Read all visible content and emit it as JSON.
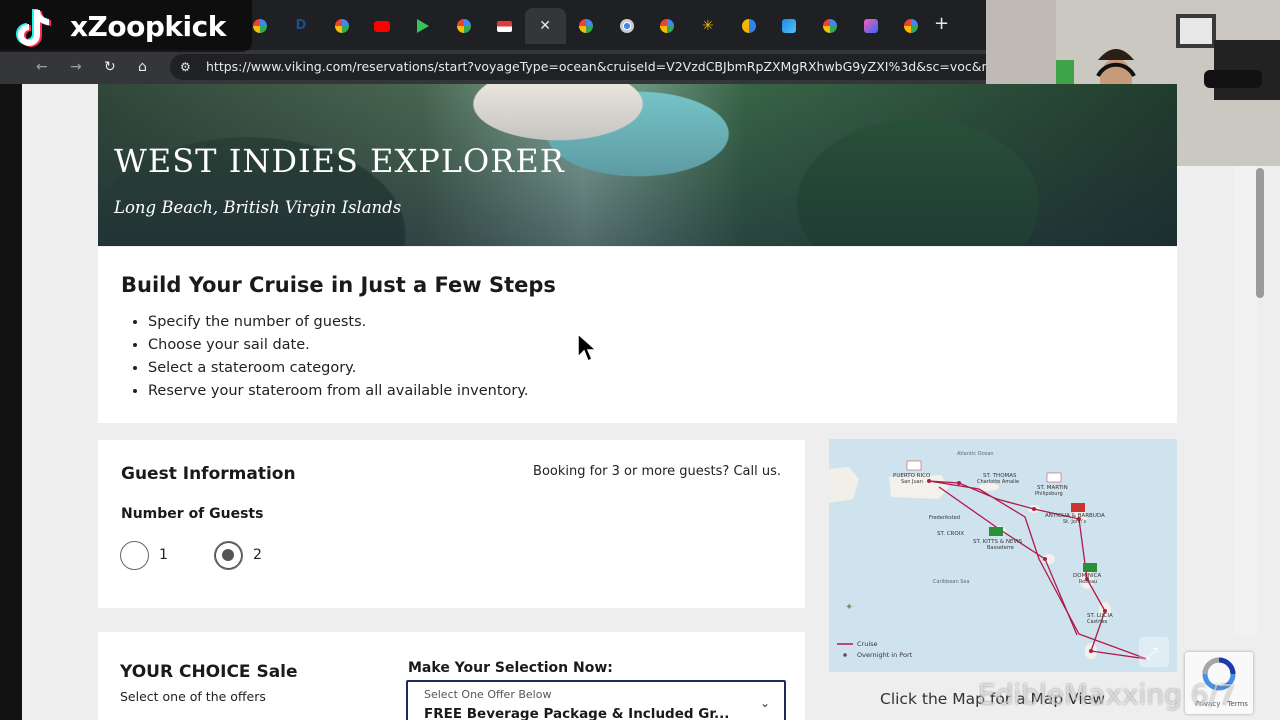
{
  "overlay": {
    "tiktok_username": "xZoopkick",
    "watermark": "EdibleMaxxing 6/7"
  },
  "browser": {
    "url": "https://www.viking.com/reservations/start?voyageType=ocean&cruiseId=V2VzdCBJbmRpZXMgRXhwbG9yZXI%3d&sc=voc&referral",
    "tab_icons": [
      "google-icon",
      "d-icon",
      "google-icon",
      "youtube-icon",
      "rumble-icon",
      "google-icon",
      "flag-icon",
      "close-icon",
      "google-icon",
      "chrome-icon",
      "google-icon",
      "walmart-icon",
      "ring-icon",
      "wave-icon",
      "google-icon",
      "clay-icon",
      "google-icon"
    ],
    "new_tab": "+"
  },
  "hero": {
    "title": "WEST INDIES EXPLORER",
    "subtitle": "Long Beach, British Virgin Islands"
  },
  "steps": {
    "heading": "Build Your Cruise in Just a Few Steps",
    "items": [
      "Specify the number of guests.",
      "Choose your sail date.",
      "Select a stateroom category.",
      "Reserve your stateroom from all available inventory."
    ]
  },
  "guest": {
    "heading": "Guest Information",
    "call_note": "Booking for 3 or more guests? Call us.",
    "number_label": "Number of Guests",
    "options": [
      "1",
      "2"
    ],
    "selected": "2"
  },
  "map": {
    "caption": "Click the Map for a Map View",
    "legend_cruise": "Cruise",
    "legend_overnight": "Overnight in Port",
    "labels": {
      "atlantic": "Atlantic Ocean",
      "pr": "PUERTO RICO",
      "pr_city": "San Juan",
      "stthomas": "ST. THOMAS",
      "stthomas_city": "Charlotte Amalie",
      "stmartin": "ST. MARTIN",
      "stmartin_city": "Philipsburg",
      "antigua": "ANTIGUA & BARBUDA",
      "antigua_city": "St. John's",
      "frederiksted": "Frederiksted",
      "stcroix": "ST. CROIX",
      "stkitts": "ST. KITTS & NEVIS",
      "stkitts_city": "Basseterre",
      "dominica": "DOMINICA",
      "dominica_city": "Roseau",
      "caribbean": "Caribbean Sea",
      "stlucia": "ST. LUCIA",
      "stlucia_city": "Castries"
    }
  },
  "sale": {
    "heading": "YOUR CHOICE Sale",
    "sub": "Select one of the offers",
    "make_selection": "Make Your Selection Now:",
    "select_placeholder": "Select One Offer Below",
    "select_value": "FREE Beverage Package & Included Gr..."
  },
  "recaptcha": {
    "label": "Privacy - Terms"
  },
  "colors": {
    "accent": "#1d2b59",
    "route": "#b01a4a",
    "browser_bg": "#1f2023"
  }
}
